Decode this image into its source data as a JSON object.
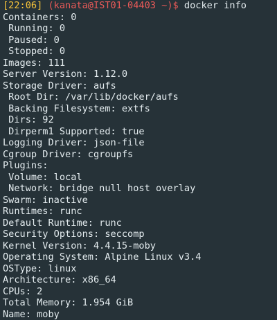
{
  "prompt": {
    "time": "[22:06]",
    "user_host": "(kanata@IST01-04403 ~)$",
    "command": "docker info"
  },
  "lines": [
    "Containers: 0",
    " Running: 0",
    " Paused: 0",
    " Stopped: 0",
    "Images: 111",
    "Server Version: 1.12.0",
    "Storage Driver: aufs",
    " Root Dir: /var/lib/docker/aufs",
    " Backing Filesystem: extfs",
    " Dirs: 92",
    " Dirperm1 Supported: true",
    "Logging Driver: json-file",
    "Cgroup Driver: cgroupfs",
    "Plugins:",
    " Volume: local",
    " Network: bridge null host overlay",
    "Swarm: inactive",
    "Runtimes: runc",
    "Default Runtime: runc",
    "Security Options: seccomp",
    "Kernel Version: 4.4.15-moby",
    "Operating System: Alpine Linux v3.4",
    "OSType: linux",
    "Architecture: x86_64",
    "CPUs: 2",
    "Total Memory: 1.954 GiB",
    "Name: moby"
  ],
  "colors": {
    "background": "#263238",
    "foreground": "#e4ecef",
    "time": "#f8c43a",
    "user_host": "#ea5a58"
  }
}
